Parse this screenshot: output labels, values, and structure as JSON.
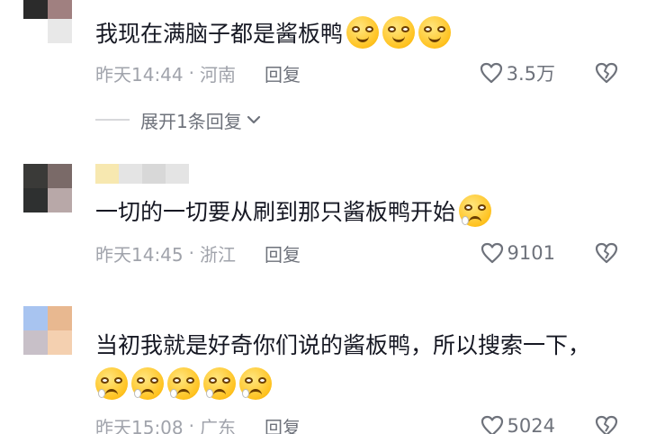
{
  "comments": [
    {
      "text": "我现在满脑子都是酱板鸭",
      "date": "昨天14:44",
      "location": "河南",
      "reply_label": "回复",
      "likes": "3.5万",
      "emoji_count": 3,
      "emoji_icon": "grinning-face-icon",
      "avatar_colors": [
        "#2b2b2b",
        "#a08080",
        "#ffffff",
        "#e8e8e8"
      ],
      "username_colors": []
    },
    {
      "text": "一切的一切要从刷到那只酱板鸭开始",
      "date": "昨天14:45",
      "location": "浙江",
      "reply_label": "回复",
      "likes": "9101",
      "emoji_count": 1,
      "emoji_icon": "pleading-face-icon",
      "avatar_colors": [
        "#3a3a38",
        "#7a6a68",
        "#2e3030",
        "#b8a8a8"
      ],
      "username_colors": [
        "#f7e8b0",
        "#e4e4e4",
        "#d8d8d8",
        "#e4e4e4"
      ]
    },
    {
      "text": "当初我就是好奇你们说的酱板鸭，所以搜索一下，",
      "date": "昨天15:08",
      "location": "广东",
      "reply_label": "回复",
      "likes": "5024",
      "emoji_count": 5,
      "emoji_icon": "pleading-face-icon",
      "avatar_colors": [
        "#a8c4f0",
        "#e8b890",
        "#c8c0c8",
        "#f4d0b0"
      ],
      "username_colors": []
    }
  ],
  "expand_replies_label": "展开1条回复",
  "colors": {
    "text_primary": "#161823",
    "text_secondary": "#a0a3ab",
    "icon_gray": "#6e727b"
  }
}
